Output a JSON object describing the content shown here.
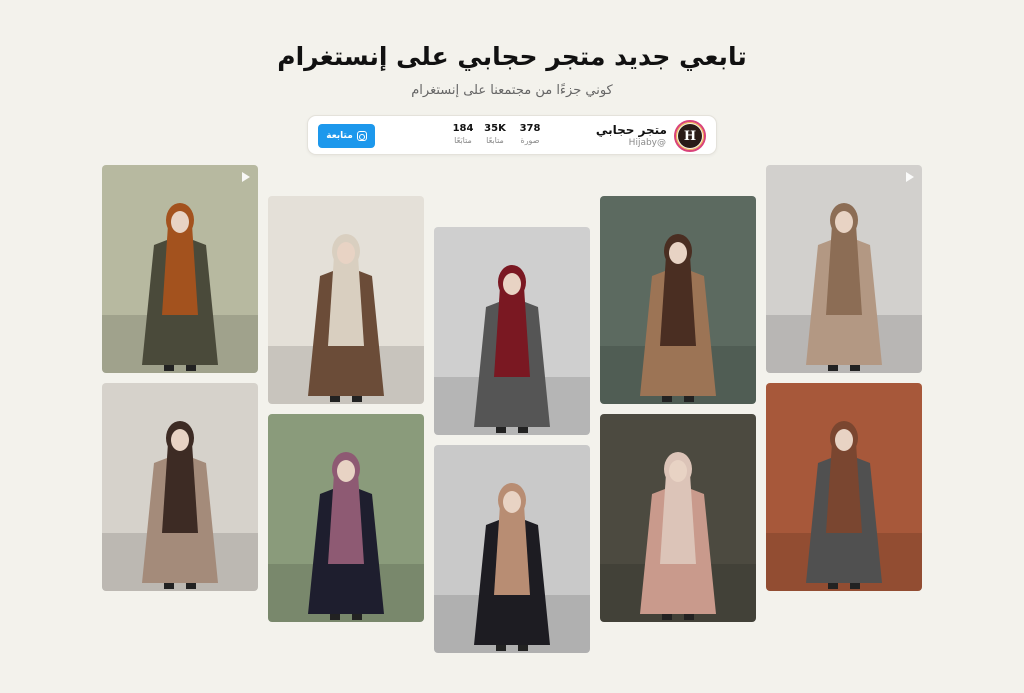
{
  "header": {
    "title": "تابعي جديد متجر حجابي على إنستغرام",
    "subtitle": "كوني جزءًا من مجتمعنا على إنستغرام"
  },
  "profile": {
    "avatar_letter": "H",
    "name": "متجر حجابي",
    "handle": "Hijaby@",
    "stats": [
      {
        "value": "378",
        "label": "صورة"
      },
      {
        "value": "35K",
        "label": "متابعًا"
      },
      {
        "value": "184",
        "label": "متابَعًا"
      }
    ],
    "follow_label": "متابعة"
  },
  "colors": {
    "background": "#f3f2ec",
    "follow_button": "#1d98ec"
  },
  "posts": [
    {
      "name": "post-olive-cardigan-mirror-selfie",
      "bg": "#b7b9a0",
      "coat": "#4a4a3a",
      "scarf": "#a3521e",
      "video": true
    },
    {
      "name": "post-brown-abaya-sunroom",
      "bg": "#e4e0d8",
      "coat": "#6b4c38",
      "scarf": "#d9cfc0",
      "video": false
    },
    {
      "name": "post-red-scarf-grey-coat",
      "bg": "#cfcfcf",
      "coat": "#555555",
      "scarf": "#7a1822",
      "video": false
    },
    {
      "name": "post-camel-coat-cafe",
      "bg": "#5c6a60",
      "coat": "#9c7455",
      "scarf": "#4a2e22",
      "video": false
    },
    {
      "name": "post-beige-cape-flowers",
      "bg": "#d2d0cd",
      "coat": "#b39883",
      "scarf": "#8c6d55",
      "video": true
    },
    {
      "name": "post-taupe-abaya-interior",
      "bg": "#d6d2cb",
      "coat": "#a48b7a",
      "scarf": "#3d2b24",
      "video": false
    },
    {
      "name": "post-navy-dress-green-door",
      "bg": "#8a9b7b",
      "coat": "#1e1e2e",
      "scarf": "#8e5a73",
      "video": false
    },
    {
      "name": "post-black-abaya-winter-gate",
      "bg": "#c9c9c9",
      "coat": "#1d1c22",
      "scarf": "#b88d73",
      "video": false
    },
    {
      "name": "post-pink-dress-hydrangeas",
      "bg": "#4c4a40",
      "coat": "#c99a8c",
      "scarf": "#dcc4b8",
      "video": false
    },
    {
      "name": "post-grey-coat-autumn-garden",
      "bg": "#a7583a",
      "coat": "#505050",
      "scarf": "#7a4630",
      "video": false
    }
  ]
}
